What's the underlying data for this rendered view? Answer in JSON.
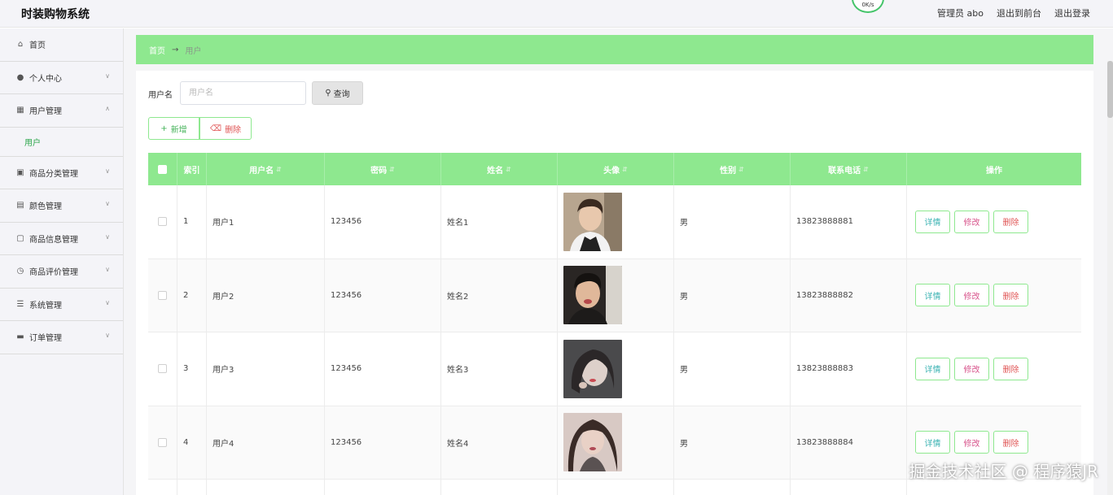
{
  "app": {
    "title": "时装购物系统",
    "net_speed": "0K/s"
  },
  "top_actions": {
    "admin": "管理员 abo",
    "back_front": "退出到前台",
    "logout": "退出登录"
  },
  "sidebar": {
    "home": "首页",
    "items": [
      {
        "label": "个人中心"
      },
      {
        "label": "用户管理"
      },
      {
        "label": "商品分类管理"
      },
      {
        "label": "颜色管理"
      },
      {
        "label": "商品信息管理"
      },
      {
        "label": "商品评价管理"
      },
      {
        "label": "系统管理"
      },
      {
        "label": "订单管理"
      }
    ],
    "sub_user": "用户"
  },
  "breadcrumb": {
    "home": "首页",
    "sep": "→",
    "current": "用户"
  },
  "search": {
    "label": "用户名",
    "placeholder": "用户名",
    "button": "查询"
  },
  "actions": {
    "add": "新增",
    "delete": "删除"
  },
  "table": {
    "headers": {
      "index": "索引",
      "username": "用户名",
      "password": "密码",
      "name": "姓名",
      "avatar": "头像",
      "gender": "性别",
      "phone": "联系电话",
      "ops": "操作"
    },
    "rows": [
      {
        "index": "1",
        "username": "用户1",
        "password": "123456",
        "name": "姓名1",
        "gender": "男",
        "phone": "13823888881"
      },
      {
        "index": "2",
        "username": "用户2",
        "password": "123456",
        "name": "姓名2",
        "gender": "男",
        "phone": "13823888882"
      },
      {
        "index": "3",
        "username": "用户3",
        "password": "123456",
        "name": "姓名3",
        "gender": "男",
        "phone": "13823888883"
      },
      {
        "index": "4",
        "username": "用户4",
        "password": "123456",
        "name": "姓名4",
        "gender": "男",
        "phone": "13823888884"
      }
    ],
    "op_labels": {
      "detail": "详情",
      "edit": "修改",
      "remove": "删除"
    }
  },
  "watermark": "掘金技术社区 @ 程序猿JR",
  "colors": {
    "accent_green": "#8ee88f",
    "text_green": "#45b35a",
    "danger": "#e05555",
    "edit_pink": "#d8558c",
    "detail_teal": "#3bb3b3"
  }
}
